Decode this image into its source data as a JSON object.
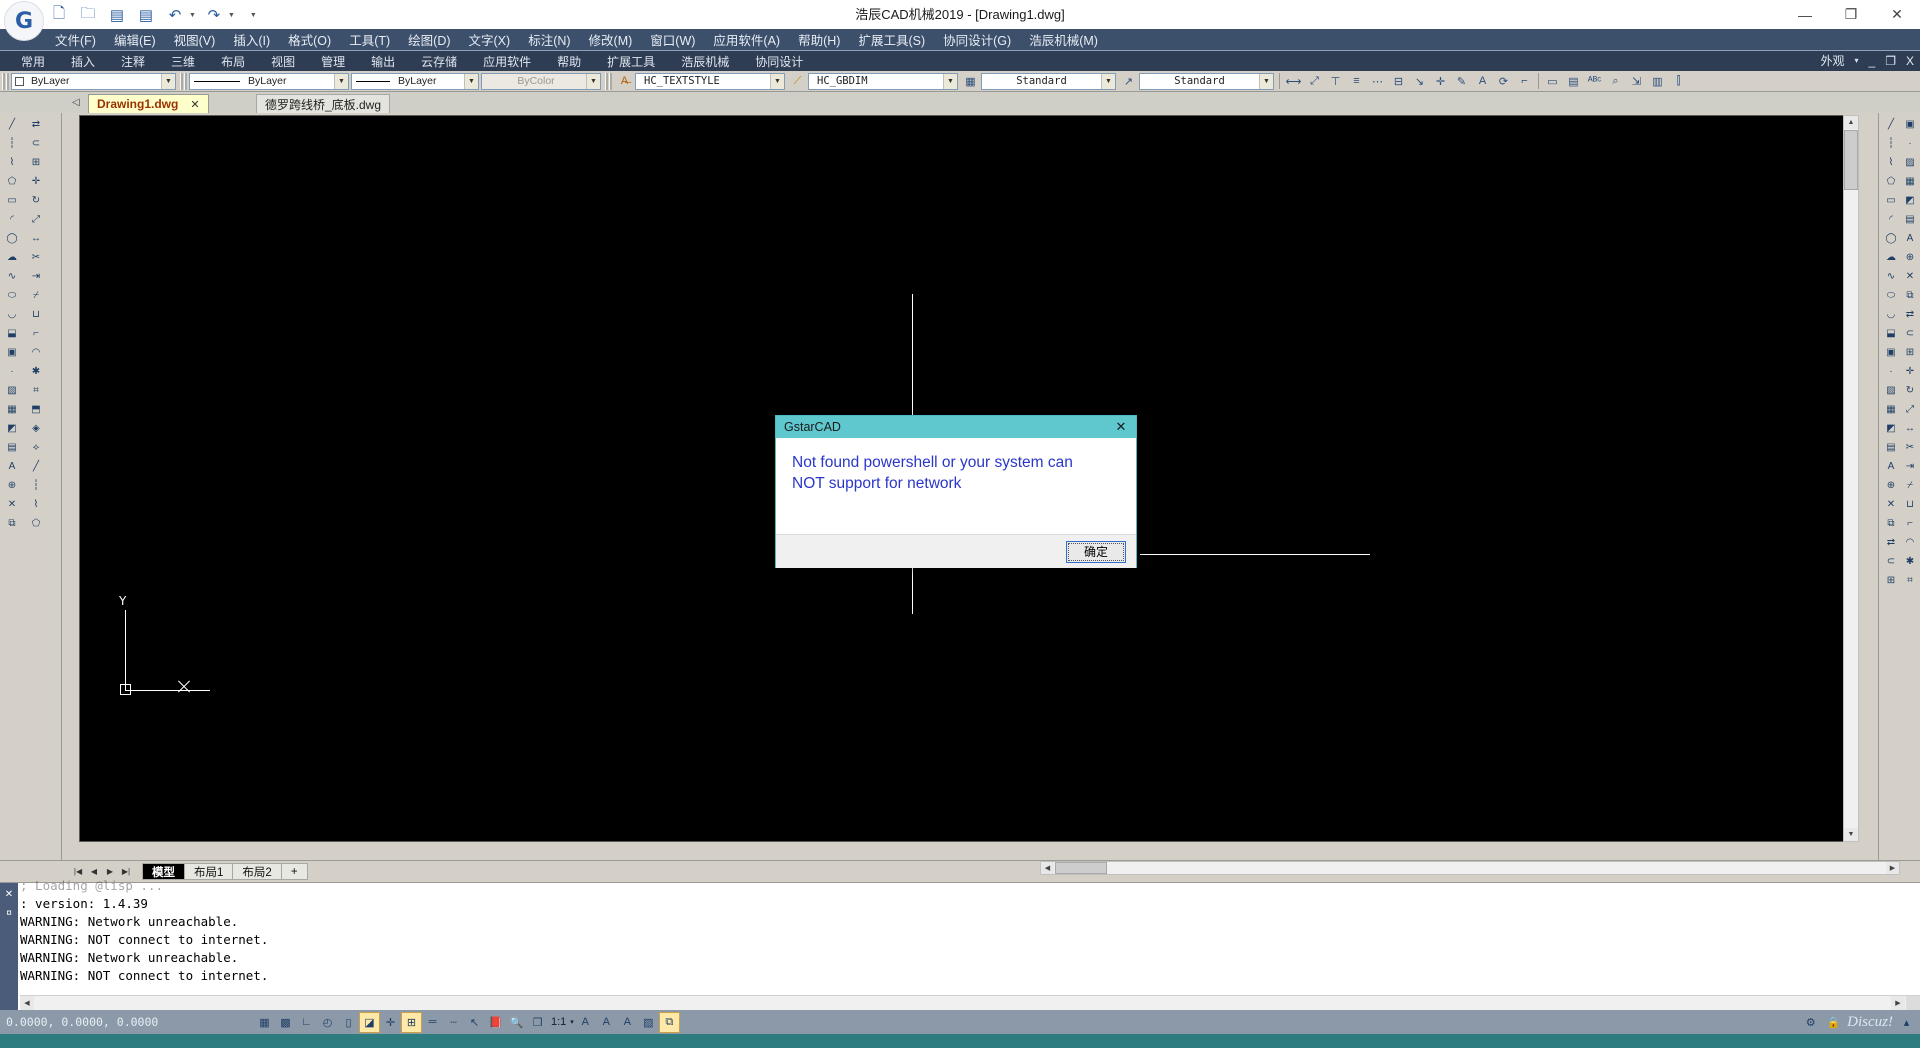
{
  "window": {
    "title": "浩辰CAD机械2019 - [Drawing1.dwg]",
    "logo_text": "G",
    "minimize": "—",
    "maximize": "❐",
    "close": "✕"
  },
  "quick_access": [
    {
      "name": "new-icon",
      "glyph": "🗋"
    },
    {
      "name": "open-icon",
      "glyph": "🗁"
    },
    {
      "name": "save-icon",
      "glyph": "🖫"
    },
    {
      "name": "save-as-icon",
      "glyph": "🖫"
    },
    {
      "name": "undo-icon",
      "glyph": "↶"
    },
    {
      "name": "redo-icon",
      "glyph": "↷"
    },
    {
      "name": "more-icon",
      "glyph": "▾"
    }
  ],
  "menubar": [
    "文件(F)",
    "编辑(E)",
    "视图(V)",
    "插入(I)",
    "格式(O)",
    "工具(T)",
    "绘图(D)",
    "文字(X)",
    "标注(N)",
    "修改(M)",
    "窗口(W)",
    "应用软件(A)",
    "帮助(H)",
    "扩展工具(S)",
    "协同设计(G)",
    "浩辰机械(M)"
  ],
  "ribbon_tabs": [
    "常用",
    "插入",
    "注释",
    "三维",
    "布局",
    "视图",
    "管理",
    "输出",
    "云存储",
    "应用软件",
    "帮助",
    "扩展工具",
    "浩辰机械",
    "协同设计"
  ],
  "ribbon_right": {
    "appearance": "外观",
    "caret": "▾",
    "minimize": "_",
    "restore": "❐",
    "close": "X"
  },
  "properties_toolbar": {
    "layer_combo": {
      "value": "ByLayer",
      "swatch": "layer-square"
    },
    "color_combo": {
      "value": "ByLayer",
      "swatch": "line"
    },
    "linetype_combo": {
      "value": "ByLayer",
      "swatch": "line"
    },
    "lineweight_combo": {
      "value": "ByColor",
      "disabled": true
    },
    "textstyle_combo": {
      "value": "HC_TEXTSTYLE"
    },
    "dimstyle_combo": {
      "value": "HC_GBDIM"
    },
    "tablestyle_combo": {
      "value": "Standard"
    },
    "multileader_combo": {
      "value": "Standard"
    }
  },
  "drawing_tabs": [
    {
      "label": "Drawing1.dwg",
      "active": true,
      "closable": true
    },
    {
      "label": "德罗跨线桥_底板.dwg",
      "active": false,
      "closable": false
    }
  ],
  "layout_tabs": [
    {
      "label": "模型",
      "active": true
    },
    {
      "label": "布局1",
      "active": false
    },
    {
      "label": "布局2",
      "active": false
    },
    {
      "label": "+",
      "active": false
    }
  ],
  "command_line": {
    "lines": [
      "; Loading @lisp ...",
      ": version: 1.4.39",
      "WARNING: Network unreachable.",
      "WARNING: NOT connect to internet.",
      "WARNING: Network unreachable.",
      "WARNING: NOT connect to internet."
    ],
    "close_glyph": "✕",
    "pin_glyph": "¤"
  },
  "status_bar": {
    "coordinates": "0.0000, 0.0000, 0.0000",
    "scale": "1:1",
    "scale_caret": "▾",
    "icons": [
      {
        "name": "grid-toggle",
        "glyph": "▦",
        "active": false
      },
      {
        "name": "snap-toggle",
        "glyph": "▩",
        "active": false
      },
      {
        "name": "ortho-toggle",
        "glyph": "∟",
        "active": false
      },
      {
        "name": "polar-toggle",
        "glyph": "◴",
        "active": false
      },
      {
        "name": "osnap-toggle",
        "glyph": "▯",
        "active": false
      },
      {
        "name": "otrack-toggle",
        "glyph": "◪",
        "active": true
      },
      {
        "name": "dynamic-ucs-toggle",
        "glyph": "✛",
        "active": false
      },
      {
        "name": "dynamic-input-toggle",
        "glyph": "⊞",
        "active": true
      },
      {
        "name": "lineweight-toggle",
        "glyph": "═",
        "active": false
      },
      {
        "name": "transparency-toggle",
        "glyph": "┄",
        "active": false
      },
      {
        "name": "selection-cycling-toggle",
        "glyph": "↖",
        "active": false
      },
      {
        "name": "annotation-visibility-toggle",
        "glyph": "📕",
        "active": false
      },
      {
        "name": "quick-properties-toggle",
        "glyph": "🔍",
        "active": false
      },
      {
        "name": "workspace-switch",
        "glyph": "❐",
        "active": false
      },
      {
        "name": "annotation-scale-icon",
        "glyph": "A",
        "active": false
      },
      {
        "name": "annotation-add-icon",
        "glyph": "A",
        "active": false
      },
      {
        "name": "annotation-sub-icon",
        "glyph": "A",
        "active": false
      },
      {
        "name": "isolate-objects-icon",
        "glyph": "▨",
        "active": false
      },
      {
        "name": "clean-screen-toggle",
        "glyph": "⧉",
        "active": true
      }
    ],
    "right_icons": [
      {
        "name": "settings-icon",
        "glyph": "⚙"
      },
      {
        "name": "lock-icon",
        "glyph": "🔒"
      },
      {
        "name": "expand-icon",
        "glyph": "▴"
      }
    ],
    "watermark": "Discuz!"
  },
  "dialog": {
    "title": "GstarCAD",
    "close_glyph": "✕",
    "message_line1": "Not found powershell or your system can",
    "message_line2": "NOT support for network",
    "ok_label": "确定",
    "title_bg": "#5ec8ce",
    "text_color": "#2a36c8"
  },
  "left_toolbar_icons": [
    "line-icon",
    "construction-line-icon",
    "polyline-icon",
    "polygon-icon",
    "rectangle-icon",
    "arc-icon",
    "circle-icon",
    "revcloud-icon",
    "spline-icon",
    "ellipse-icon",
    "ellipse-arc-icon",
    "insert-block-icon",
    "make-block-icon",
    "point-icon",
    "hatch-icon",
    "gradient-icon",
    "region-icon",
    "table-icon",
    "multiline-text-icon",
    "add-selected-icon",
    "erase-icon",
    "copy-icon",
    "mirror-icon",
    "offset-icon",
    "array-icon",
    "move-icon",
    "rotate-icon",
    "scale-icon",
    "stretch-icon",
    "trim-icon",
    "extend-icon",
    "break-icon",
    "join-icon",
    "chamfer-icon",
    "fillet-icon",
    "explode-icon"
  ],
  "right_toolbar_icons": [
    "layers-icon",
    "layer-properties-icon",
    "layer-state-icon",
    "make-current-icon",
    "match-layer-icon",
    "prev-layer-icon",
    "isolate-layer-icon",
    "unisolate-layer-icon",
    "freeze-layer-icon",
    "off-layer-icon",
    "lock-layer-icon",
    "unlock-layer-icon",
    "merge-layer-icon",
    "delete-layer-icon",
    "text-style-icon",
    "dim-style-icon",
    "table-style-icon",
    "point-style-icon",
    "units-icon",
    "thickness-icon",
    "render-icon",
    "view-icon",
    "viewport-icon",
    "ucs-icon",
    "plot-icon"
  ]
}
